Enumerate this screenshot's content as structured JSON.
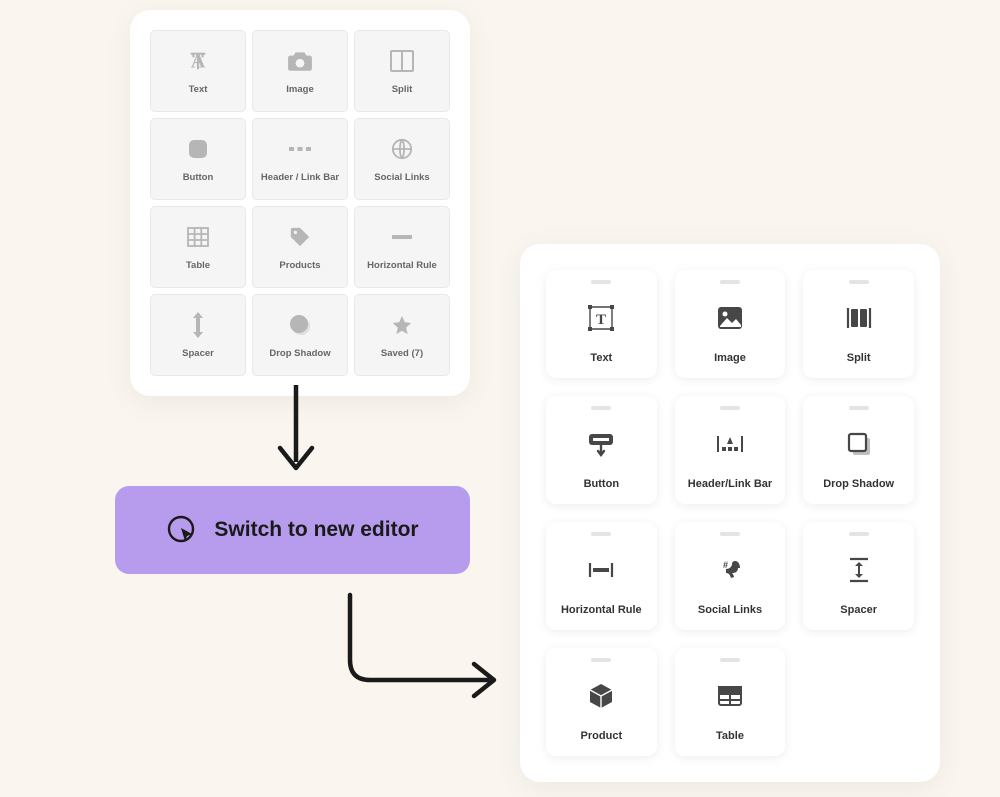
{
  "oldPanel": {
    "items": [
      {
        "label": "Text",
        "icon": "text"
      },
      {
        "label": "Image",
        "icon": "image-cam"
      },
      {
        "label": "Split",
        "icon": "split-old"
      },
      {
        "label": "Button",
        "icon": "button-shape"
      },
      {
        "label": "Header / Link Bar",
        "icon": "dots"
      },
      {
        "label": "Social Links",
        "icon": "globe"
      },
      {
        "label": "Table",
        "icon": "table-old"
      },
      {
        "label": "Products",
        "icon": "tag"
      },
      {
        "label": "Horizontal Rule",
        "icon": "hr-old"
      },
      {
        "label": "Spacer",
        "icon": "spacer-old"
      },
      {
        "label": "Drop Shadow",
        "icon": "shadow-old"
      },
      {
        "label": "Saved (7)",
        "icon": "star"
      }
    ]
  },
  "newPanel": {
    "items": [
      {
        "label": "Text",
        "icon": "text-frame"
      },
      {
        "label": "Image",
        "icon": "image"
      },
      {
        "label": "Split",
        "icon": "split-new"
      },
      {
        "label": "Button",
        "icon": "button-click"
      },
      {
        "label": "Header/Link Bar",
        "icon": "header-bar"
      },
      {
        "label": "Drop Shadow",
        "icon": "shadow-new"
      },
      {
        "label": "Horizontal Rule",
        "icon": "hr-new"
      },
      {
        "label": "Social Links",
        "icon": "social"
      },
      {
        "label": "Spacer",
        "icon": "spacer-new"
      },
      {
        "label": "Product",
        "icon": "box"
      },
      {
        "label": "Table",
        "icon": "table-new"
      }
    ]
  },
  "cta": {
    "label": "Switch to new editor"
  }
}
